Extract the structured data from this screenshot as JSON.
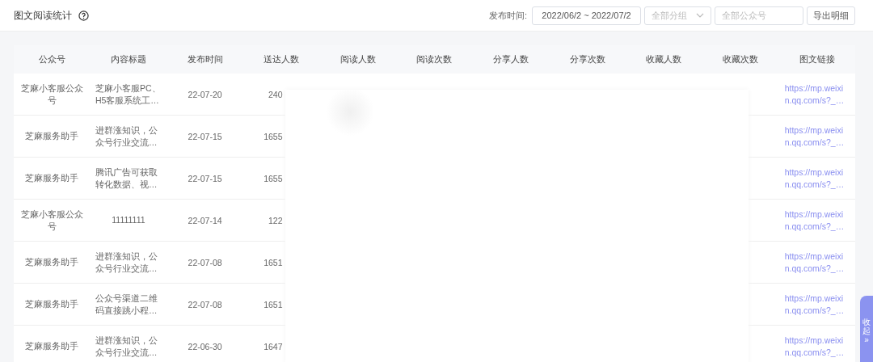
{
  "header": {
    "title": "图文阅读统计",
    "filters": {
      "date_label": "发布时间:",
      "date_range": "2022/06/2 ~ 2022/07/2",
      "group_select": {
        "placeholder": "全部分组"
      },
      "account_field": {
        "placeholder": "全部公众号"
      },
      "export_button": "导出明细"
    }
  },
  "table": {
    "columns": [
      "公众号",
      "内容标题",
      "发布时间",
      "送达人数",
      "阅读人数",
      "阅读次数",
      "分享人数",
      "分享次数",
      "收藏人数",
      "收藏次数",
      "图文链接"
    ],
    "rows": [
      {
        "account": "芝麻小客服公众号",
        "title": "芝麻小客服PC、H5客服系统工…",
        "date": "22-07-20",
        "delivered": "240",
        "link": "https://mp.weixin.qq.com/s?_…"
      },
      {
        "account": "芝麻服务助手",
        "title": "进群涨知识，公众号行业交流…",
        "date": "22-07-15",
        "delivered": "1655",
        "link": "https://mp.weixin.qq.com/s?_…"
      },
      {
        "account": "芝麻服务助手",
        "title": "腾讯广告可获取转化数据、视…",
        "date": "22-07-15",
        "delivered": "1655",
        "link": "https://mp.weixin.qq.com/s?_…"
      },
      {
        "account": "芝麻小客服公众号",
        "title": "11111111",
        "date": "22-07-14",
        "delivered": "122",
        "link": "https://mp.weixin.qq.com/s?_…"
      },
      {
        "account": "芝麻服务助手",
        "title": "进群涨知识，公众号行业交流…",
        "date": "22-07-08",
        "delivered": "1651",
        "link": "https://mp.weixin.qq.com/s?_…"
      },
      {
        "account": "芝麻服务助手",
        "title": "公众号渠道二维码直接跳小程…",
        "date": "22-07-08",
        "delivered": "1651",
        "link": "https://mp.weixin.qq.com/s?_…"
      },
      {
        "account": "芝麻服务助手",
        "title": "进群涨知识，公众号行业交流…",
        "date": "22-06-30",
        "delivered": "1647",
        "link": "https://mp.weixin.qq.com/s?_…"
      }
    ]
  },
  "side_tab": {
    "label": "收起",
    "arrow": "»"
  }
}
